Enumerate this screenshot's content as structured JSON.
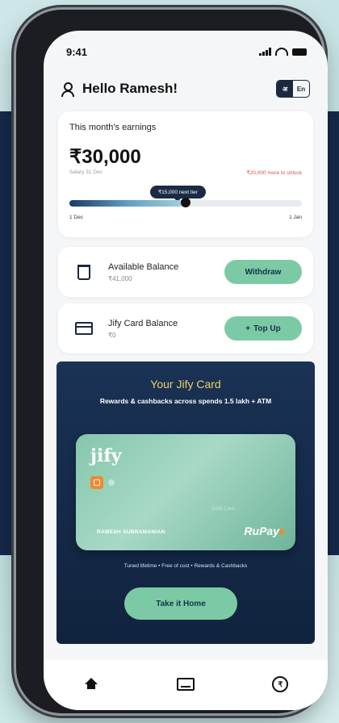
{
  "status_bar": {
    "time": "9:41"
  },
  "header": {
    "greeting": "Hello Ramesh!",
    "lang_on": "अ",
    "lang_off": "En"
  },
  "earnings": {
    "title": "This month's earnings",
    "amount": "₹30,000",
    "sub": "Salary 31 Dec",
    "note": "₹20,000 more to unlock",
    "pill": "₹15,000 next tier",
    "start_label": "1 Dec",
    "end_label": "1 Jan",
    "progress": 0.5
  },
  "available": {
    "title": "Available Balance",
    "value": "₹41,000",
    "button": "Withdraw"
  },
  "jify_balance": {
    "title": "Jify Card Balance",
    "value": "₹0",
    "button": "Top Up",
    "button_icon": "+"
  },
  "promo": {
    "title": "Your Jify Card",
    "subtitle": "Rewards & cashbacks across spends 1.5 lakh + ATM",
    "card_logo": "jify",
    "card_faint_text": "Debit Card",
    "card_number": "RAMESH SUBRAMANIAN",
    "network": "RuPay",
    "features": "Tuned lifetime  •  Free of cost  •  Rewards & Cashbacks",
    "button": "Take it Home"
  },
  "nav": {
    "items": [
      "home-icon",
      "card-icon",
      "rupee-icon"
    ],
    "rupee_glyph": "₹"
  },
  "colors": {
    "primary_dark": "#1b2940",
    "accent_green": "#7ccaa5",
    "promo_bg": "#10233e"
  }
}
